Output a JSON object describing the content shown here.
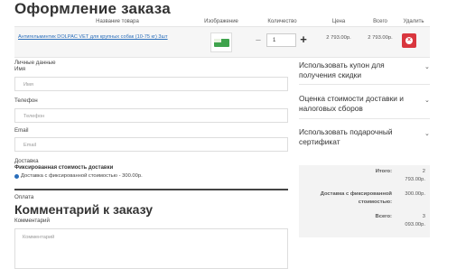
{
  "page": {
    "title": "Оформление заказа"
  },
  "cart": {
    "headers": {
      "name": "Название товара",
      "image": "Изображение",
      "quantity": "Количество",
      "price": "Цена",
      "total": "Всего",
      "remove": "Удалить"
    },
    "item": {
      "name": "Антигельминтик DOLPAC VET для крупных собак (10-75 кг) 3шт",
      "image_icon": "product-package",
      "qty_minus": "−",
      "quantity": "1",
      "qty_plus": "+",
      "price": "2 793.00р.",
      "total": "2 793.00р."
    }
  },
  "form": {
    "personal_section": "Личные данные",
    "name_label": "Имя",
    "name_placeholder": "Имя",
    "phone_label": "Телефон",
    "phone_placeholder": "Телефон",
    "email_label": "Email",
    "email_placeholder": "Email",
    "delivery_label": "Доставка",
    "delivery_method_title": "Фиксированная стоимость доставки",
    "delivery_option": "Доставка с фиксированной стоимостью - 300.00р.",
    "payment_label": "Оплата",
    "comment_heading": "Комментарий к заказу",
    "comment_label": "Комментарий",
    "comment_placeholder": "Комментарий"
  },
  "sidebar": {
    "coupon": "Использовать купон для получения скидки",
    "shipping_estimate": "Оценка стоимости доставки и налоговых сборов",
    "gift_certificate": "Использовать подарочный сертификат",
    "chevron": "⌄"
  },
  "totals": {
    "subtotal_label": "Итого:",
    "subtotal_line1": "2",
    "subtotal_line2": "793.00р.",
    "shipping_label_1": "Доставка с фиксированной",
    "shipping_label_2": "стоимостью:",
    "shipping_value": "300.00р.",
    "grand_label": "Всего:",
    "grand_line1": "3",
    "grand_line2": "093.00р."
  },
  "colors": {
    "accent": "#2a6ebb",
    "delete": "#d9363e"
  }
}
